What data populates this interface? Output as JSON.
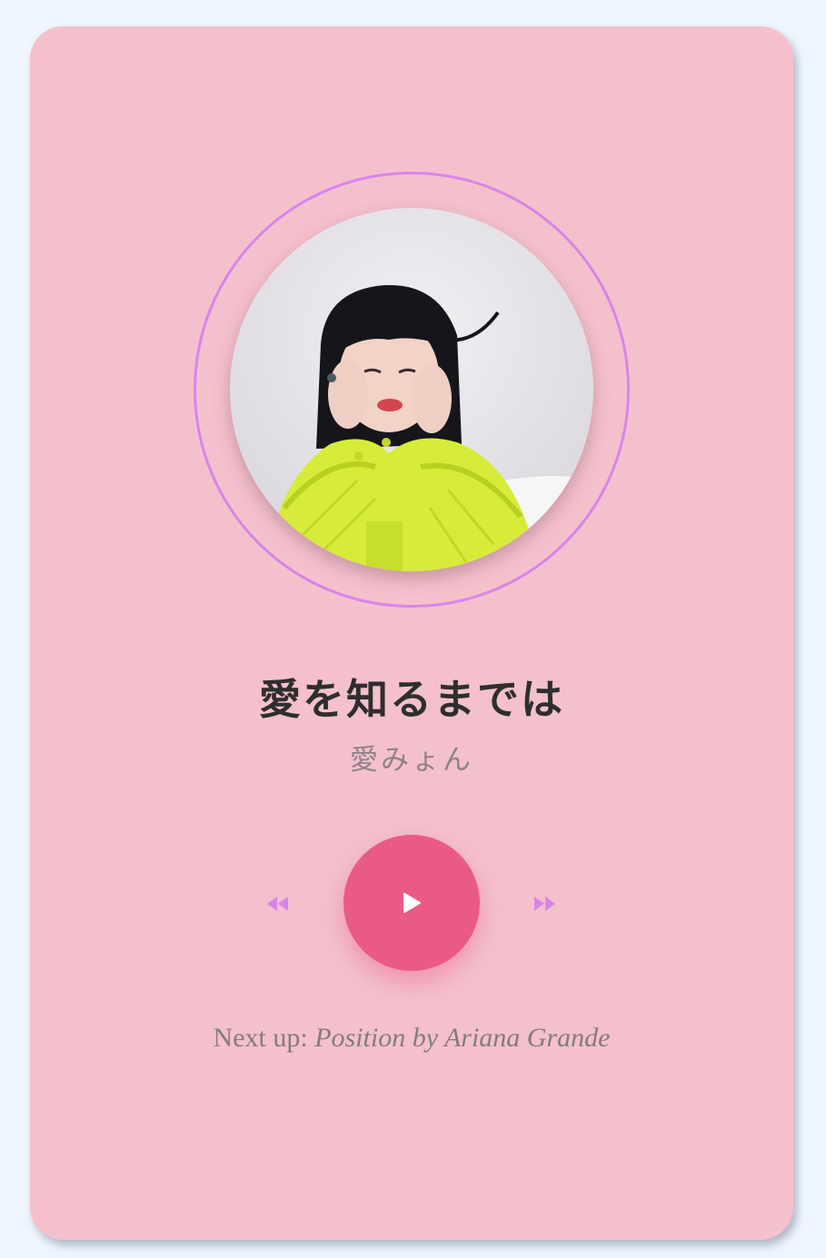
{
  "track": {
    "title": "愛を知るまでは",
    "artist": "愛みょん"
  },
  "controls": {
    "prev_icon": "rewind-icon",
    "play_icon": "play-icon",
    "next_icon": "fast-forward-icon"
  },
  "next_up": {
    "label": "Next up:",
    "song": "Position by Ariana Grande"
  },
  "album_art": {
    "icon": "artist-portrait-image"
  },
  "colors": {
    "background": "#eff6ff",
    "card": "#f4c0cc",
    "ring": "#d884ea",
    "accent": "#e95b84",
    "control_icons": "#d884ea"
  }
}
